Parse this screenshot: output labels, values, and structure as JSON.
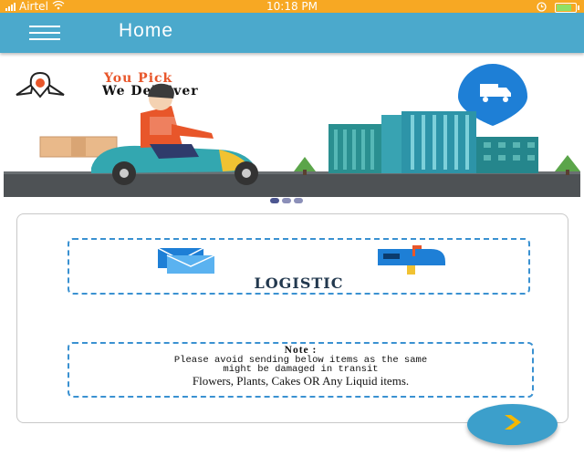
{
  "status_bar": {
    "carrier": "Airtel",
    "time": "10:18 PM",
    "battery_level": 0.85,
    "icons": [
      "signal-icon",
      "wifi-icon",
      "alarm-icon",
      "battery-charging-icon"
    ]
  },
  "app_bar": {
    "title": "Home",
    "menu_icon": "hamburger-menu-icon"
  },
  "banner": {
    "tagline_line1": "You Pick",
    "tagline_line2": "We Delhiver",
    "colors": {
      "accent": "#e8562a",
      "brand_blue": "#1e7fd6"
    },
    "page_indicator": {
      "total": 3,
      "active": 1
    }
  },
  "service": {
    "label": "LOGISTIC",
    "icons": [
      "mail-envelope-icon",
      "mailbox-icon"
    ]
  },
  "note": {
    "title": "Note :",
    "line1": "Please avoid sending below items as the same",
    "line2": "might be damaged in transit",
    "items": "Flowers, Plants, Cakes  OR Any Liquid items."
  },
  "fab": {
    "icon": "chevron-right-icon",
    "accent": "#f5b800"
  }
}
